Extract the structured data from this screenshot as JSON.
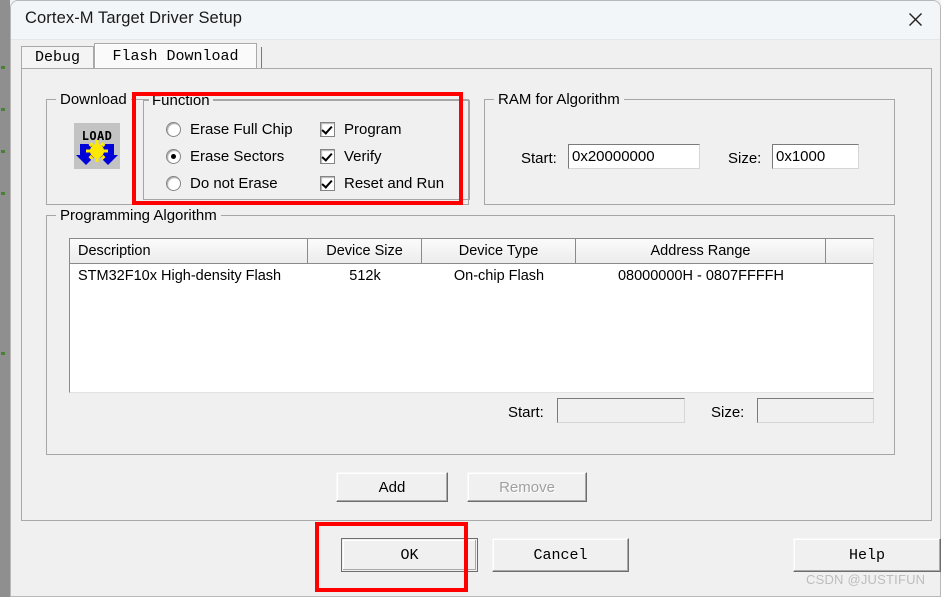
{
  "window": {
    "title": "Cortex-M Target Driver Setup",
    "close_icon": "close-icon"
  },
  "tabs": [
    {
      "label": "Debug",
      "active": false
    },
    {
      "label": "Flash Download",
      "active": true
    }
  ],
  "download_function": {
    "group_label": "Download",
    "icon_label": "LOAD",
    "function_label": "Function",
    "erase_options": [
      {
        "label": "Erase Full Chip",
        "selected": false
      },
      {
        "label": "Erase Sectors",
        "selected": true
      },
      {
        "label": "Do not Erase",
        "selected": false
      }
    ],
    "checkboxes": [
      {
        "label": "Program",
        "checked": true
      },
      {
        "label": "Verify",
        "checked": true
      },
      {
        "label": "Reset and Run",
        "checked": true
      }
    ]
  },
  "ram_for_algorithm": {
    "group_label": "RAM for Algorithm",
    "start_label": "Start:",
    "start_value": "0x20000000",
    "size_label": "Size:",
    "size_value": "0x1000"
  },
  "programming_algorithm": {
    "group_label": "Programming Algorithm",
    "columns": [
      "Description",
      "Device Size",
      "Device Type",
      "Address Range"
    ],
    "rows": [
      {
        "description": "STM32F10x High-density Flash",
        "device_size": "512k",
        "device_type": "On-chip Flash",
        "address_range": "08000000H - 0807FFFFH"
      }
    ],
    "start_label": "Start:",
    "start_value": "",
    "size_label": "Size:",
    "size_value": "",
    "add_label": "Add",
    "remove_label": "Remove",
    "remove_enabled": false
  },
  "footer": {
    "ok_label": "OK",
    "cancel_label": "Cancel",
    "help_label": "Help"
  },
  "watermark": "CSDN @JUSTIFUN",
  "colors": {
    "annotation": "#ff0000",
    "dialog_face": "#f0f0f0",
    "titlebar": "#f3f6f9"
  }
}
